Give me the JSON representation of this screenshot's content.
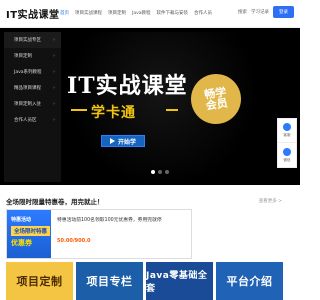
{
  "header": {
    "logo": "IT实战课堂",
    "nav": [
      "首页",
      "项目实战课程",
      "项目定制",
      "Java教程",
      "软件下载与安装",
      "合作人员",
      "合作入驻"
    ],
    "active_index": 0,
    "search": "搜索",
    "study": "学习记录",
    "login": "登录"
  },
  "sidebar": {
    "items": [
      "项目实战专区",
      "项目定制",
      "Java系列教程",
      "精品项目课程",
      "项目定制入驻",
      "合作人员区"
    ]
  },
  "banner": {
    "title": "IT实战课堂",
    "subtitle": "学卡通",
    "badge": "畅学会员",
    "enroll": "开始学"
  },
  "tools": {
    "items": [
      {
        "label": "客服",
        "icon": "headset-icon"
      },
      {
        "label": "微信",
        "icon": "wechat-icon"
      }
    ]
  },
  "promo": {
    "title": "全场限时限量特惠卷，用完就止！",
    "more": "查看更多 >",
    "card": {
      "img_line1": "特惠活动",
      "img_line2": "全场限时特惠",
      "img_line3": "优惠券",
      "title": "特惠活动前100名领取100元优惠券，券用完就停",
      "price": "50.00/900.0"
    }
  },
  "tiles": [
    {
      "label": "项目定制"
    },
    {
      "label": "项目专栏"
    },
    {
      "label": "Java零基础全套"
    },
    {
      "label": "平台介绍"
    }
  ],
  "colors": {
    "accent": "#2f6ff5",
    "banner_bg": "#000000",
    "gold": "#f1c40f",
    "price": "#ff5a00"
  }
}
